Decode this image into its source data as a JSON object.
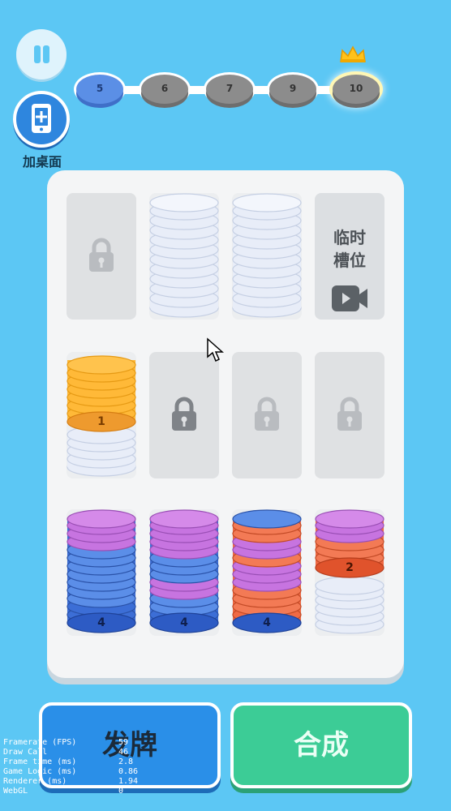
{
  "levels": [
    {
      "label": "5",
      "state": "current"
    },
    {
      "label": "6",
      "state": "locked"
    },
    {
      "label": "7",
      "state": "locked"
    },
    {
      "label": "9",
      "state": "locked"
    },
    {
      "label": "10",
      "state": "final"
    }
  ],
  "desktop_button_label": "加桌面",
  "temp_slot": {
    "line1": "临时",
    "line2": "槽位"
  },
  "stacks": [
    {
      "top_count": "1",
      "top_color": "#ffb938"
    },
    {
      "top_count": "4",
      "top_color": "#3c6ed6"
    },
    {
      "top_count": "4",
      "top_color": "#3c6ed6"
    },
    {
      "top_count": "4",
      "top_color": "#3c6ed6"
    },
    {
      "top_count": "2",
      "top_color": "#f06a44"
    }
  ],
  "buttons": {
    "deal": "发牌",
    "merge": "合成"
  },
  "stats": [
    {
      "label": "Framerate (FPS)",
      "value": "59"
    },
    {
      "label": "Draw Call",
      "value": "46"
    },
    {
      "label": "Frame time (ms)",
      "value": "2.8"
    },
    {
      "label": "Game Logic (ms)",
      "value": "0.86"
    },
    {
      "label": "Renderer (ms)",
      "value": "1.94"
    },
    {
      "label": "WebGL",
      "value": "0"
    }
  ],
  "colors": {
    "background": "#5cc7f4",
    "orange": "#ffb938",
    "blue": "#3c6ed6",
    "purple": "#c774e0",
    "coral": "#f06a44",
    "empty_chip": "#e8edf8"
  }
}
